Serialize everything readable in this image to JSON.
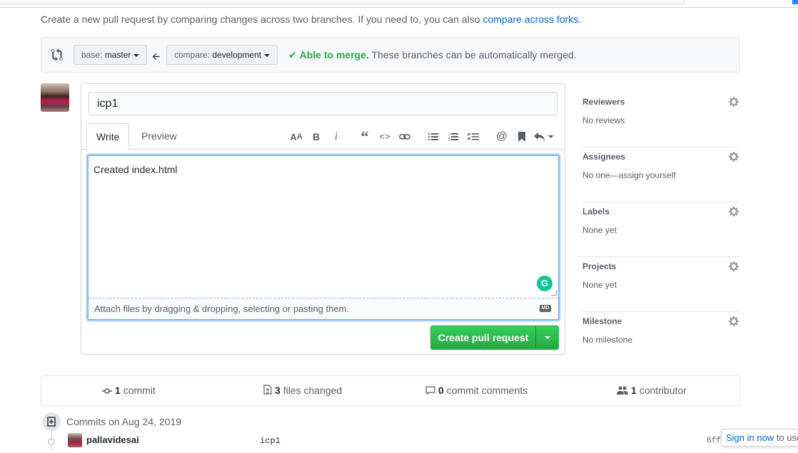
{
  "intro": {
    "text": "Create a new pull request by comparing changes across two branches. If you need to, you can also ",
    "link": "compare across forks",
    "suffix": "."
  },
  "range": {
    "base_prefix": "base:",
    "base_branch": "master",
    "compare_prefix": "compare:",
    "compare_branch": "development",
    "merge_ok": "Able to merge.",
    "merge_detail": "These branches can be automatically merged."
  },
  "form": {
    "title_value": "icp1",
    "tabs": [
      "Write",
      "Preview"
    ],
    "toolbar_icons": [
      "text-size-icon",
      "bold-icon",
      "italic-icon",
      "quote-icon",
      "code-icon",
      "link-icon",
      "unordered-list-icon",
      "ordered-list-icon",
      "task-list-icon",
      "mention-icon",
      "saved-reply-icon",
      "reply-icon"
    ],
    "body_value": "Created index.html",
    "attach_text": "Attach files by dragging & dropping, selecting or pasting them.",
    "markdown_badge": "MD",
    "grammarly_badge": "G",
    "submit_label": "Create pull request"
  },
  "sidebar": [
    {
      "title": "Reviewers",
      "value": "No reviews"
    },
    {
      "title": "Assignees",
      "value": "No one—assign yourself"
    },
    {
      "title": "Labels",
      "value": "None yet"
    },
    {
      "title": "Projects",
      "value": "None yet"
    },
    {
      "title": "Milestone",
      "value": "No milestone"
    }
  ],
  "summary": {
    "commits_count": "1",
    "commits_label": "commit",
    "files_count": "3",
    "files_label": "files changed",
    "comments_count": "0",
    "comments_label": "commit comments",
    "contributors_count": "1",
    "contributors_label": "contributor"
  },
  "commits": {
    "heading": "Commits on Aug 24, 2019",
    "rows": [
      {
        "author": "pallavidesai",
        "message": "icp1",
        "sha": "6ff"
      }
    ]
  },
  "signin": {
    "link": "Sign in now",
    "suffix": " to use"
  },
  "colors": {
    "accent": "#0366d6",
    "success": "#28a745",
    "focus": "#79b8ff"
  }
}
